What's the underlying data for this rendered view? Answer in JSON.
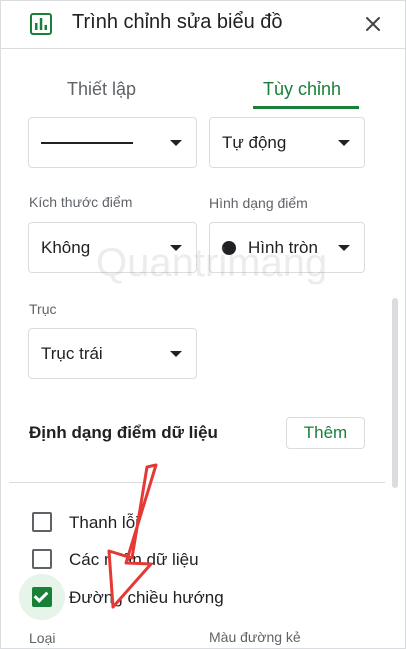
{
  "header": {
    "title": "Trình chỉnh sửa biểu đồ",
    "chart_icon": "bar-chart-icon",
    "close_icon": "close-icon"
  },
  "tabs": [
    {
      "label": "Thiết lập",
      "active": false
    },
    {
      "label": "Tùy chỉnh",
      "active": true
    }
  ],
  "series": {
    "line_style": "",
    "line_thickness_value": "Tự động",
    "point_size_label": "Kích thước điểm",
    "point_size_value": "Không",
    "point_shape_label": "Hình dạng điểm",
    "point_shape_value": "Hình tròn",
    "axis_label": "Trục",
    "axis_value": "Trục trái"
  },
  "data_point_format": {
    "title": "Định dạng điểm dữ liệu",
    "add_label": "Thêm"
  },
  "checkboxes": [
    {
      "label": "Thanh lỗi",
      "checked": false
    },
    {
      "label": "Các nhãn dữ liệu",
      "checked": false
    },
    {
      "label": "Đường chiều hướng",
      "checked": true
    }
  ],
  "trendline": {
    "type_label": "Loại",
    "line_color_label": "Màu đường kẻ"
  },
  "colors": {
    "accent": "#188038",
    "annotation_arrow": "#e53935"
  }
}
